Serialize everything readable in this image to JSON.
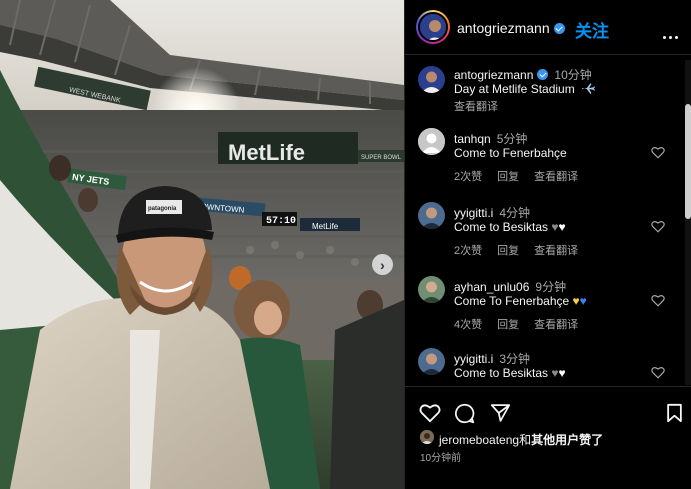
{
  "post": {
    "author": "antogriezmann",
    "follow_label": "关注",
    "verified": true
  },
  "caption": {
    "username": "antogriezmann",
    "time": "10分钟",
    "text": "Day at Metlife Stadium",
    "translate": "查看翻译"
  },
  "comments": [
    {
      "username": "tanhqn",
      "time": "5分钟",
      "text": "Come to Fenerbahçe",
      "likes": "2次赞",
      "reply": "回复",
      "translate": "查看翻译",
      "hearts": []
    },
    {
      "username": "yyigitti.i",
      "time": "4分钟",
      "text": "Come to Besiktas",
      "likes": "2次赞",
      "reply": "回复",
      "translate": "查看翻译",
      "hearts": [
        "black-heart",
        "white-heart"
      ]
    },
    {
      "username": "ayhan_unlu06",
      "time": "9分钟",
      "text": "Come To Fenerbahçe",
      "likes": "4次赞",
      "reply": "回复",
      "translate": "查看翻译",
      "hearts": [
        "yellow-heart",
        "blue-heart"
      ]
    },
    {
      "username": "yyigitti.i",
      "time": "3分钟",
      "text": "Come to Besiktas",
      "likes": "",
      "reply": "",
      "translate": "",
      "hearts": [
        "black-heart",
        "white-heart"
      ]
    }
  ],
  "likes_line": {
    "user": "jeromeboateng",
    "connector": "和",
    "others": "其他用户赞了"
  },
  "post_time": "10分钟前",
  "photo_signs": {
    "metlife": "MetLife",
    "ny_jets": "NY JETS",
    "downtown": "DOWNTOWN",
    "clock": "57:10",
    "metlife_small": "MetLife",
    "west_bank": "WEST WEBANK",
    "super_bowl": "SUPER BOWL",
    "cap_logo": "patagonia"
  },
  "colors": {
    "accent": "#0095f6",
    "verified": "#3797f0",
    "secondary_text": "#a8a8a8",
    "background": "#000000"
  },
  "icons": [
    "more-icon",
    "heart-icon",
    "comment-icon",
    "share-icon",
    "bookmark-icon",
    "chevron-right-icon",
    "airplane-icon"
  ]
}
